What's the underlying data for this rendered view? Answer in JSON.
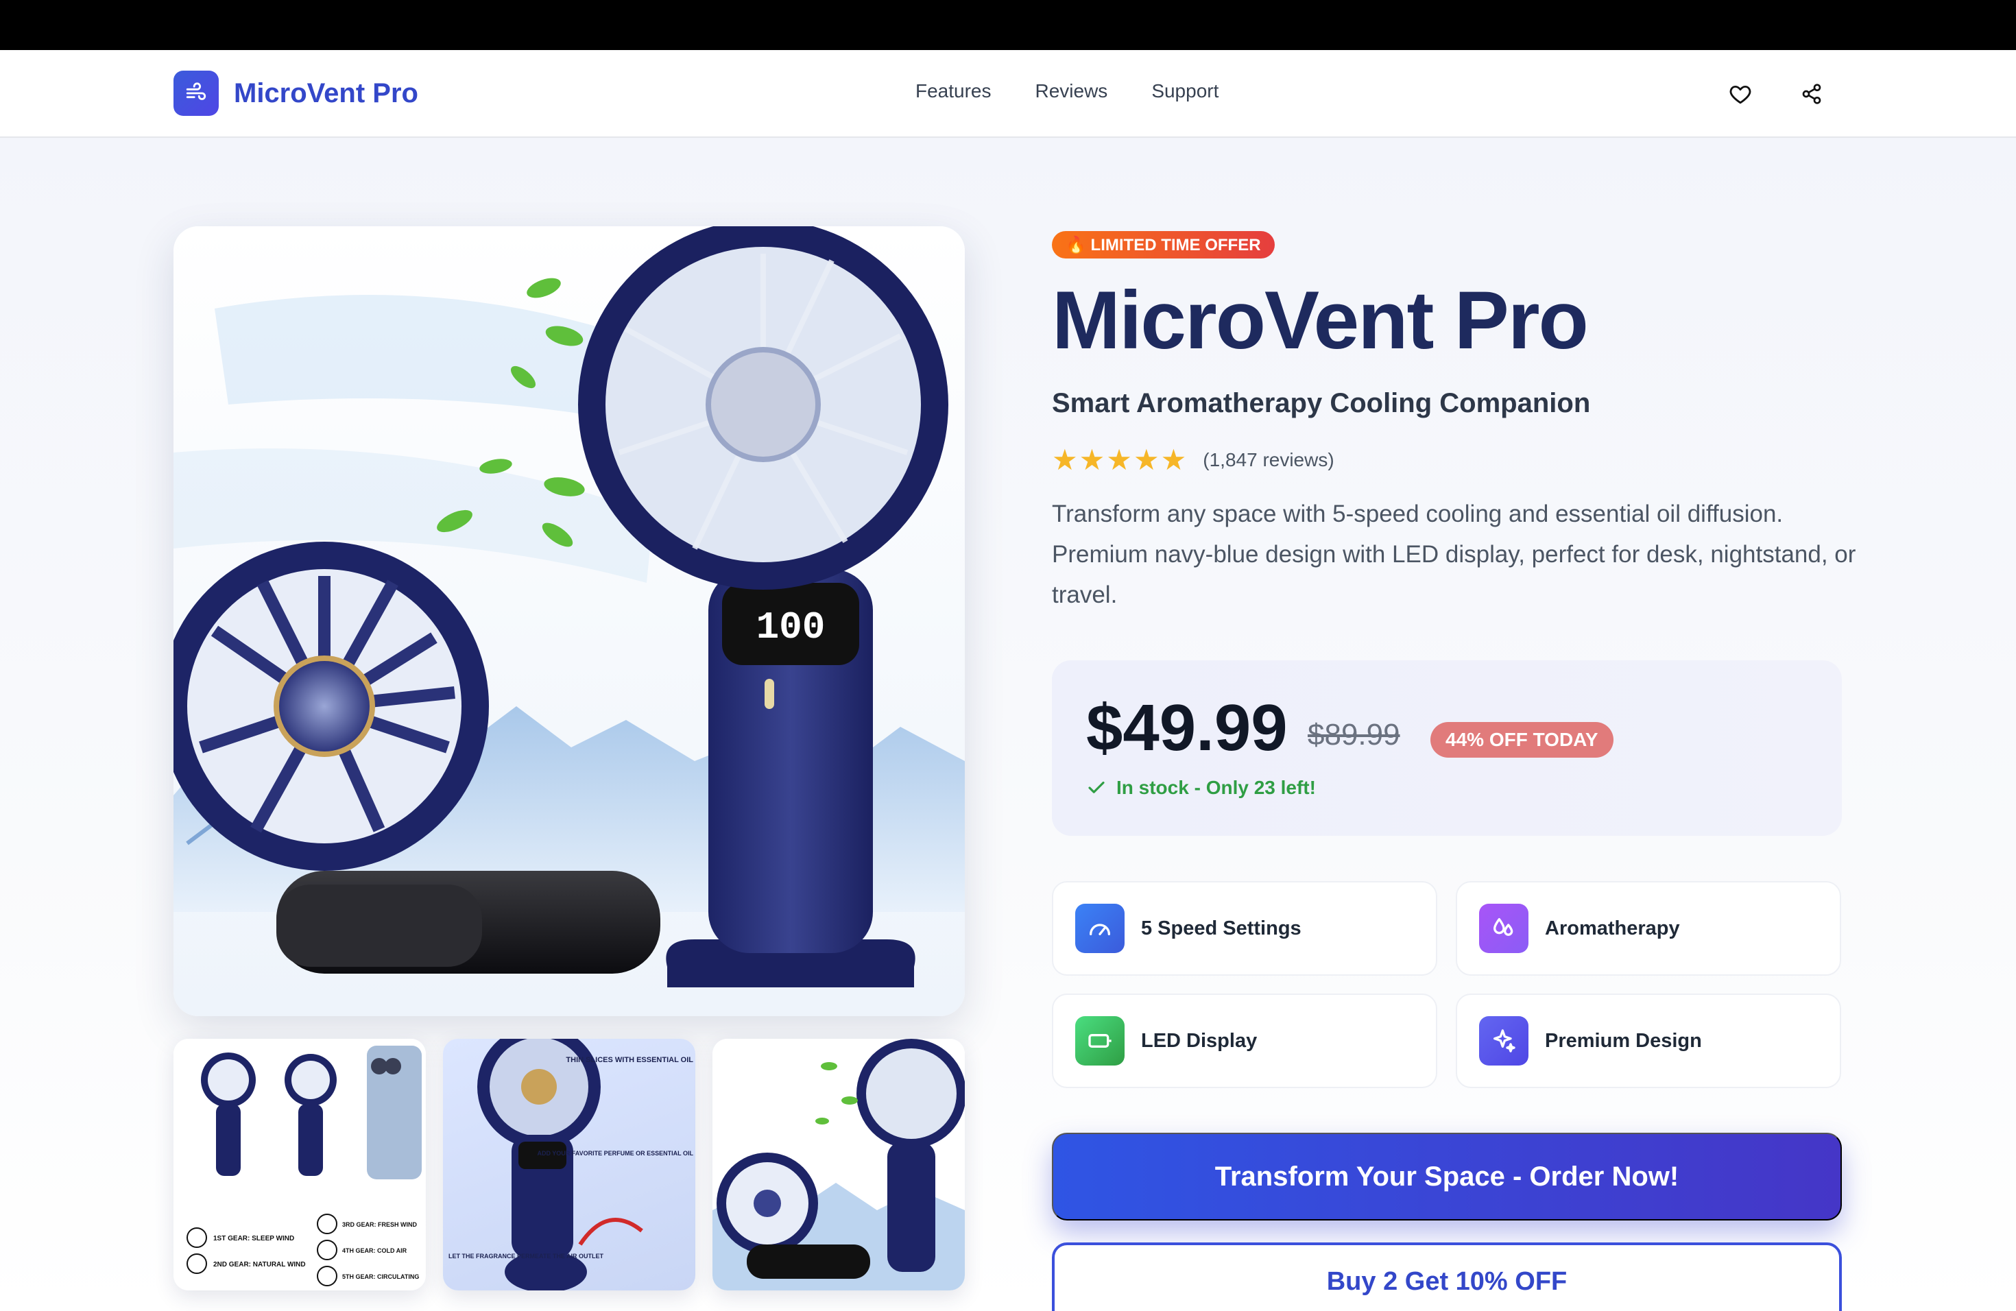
{
  "nav": {
    "brand": "MicroVent Pro",
    "links": [
      "Features",
      "Reviews",
      "Support"
    ],
    "icons": [
      "heart-icon",
      "share-icon"
    ]
  },
  "product": {
    "badge": "🔥 LIMITED TIME OFFER",
    "title": "MicroVent Pro",
    "subtitle": "Smart Aromatherapy Cooling Companion",
    "rating_stars": "★★★★★",
    "rating": 5,
    "review_count": "(1,847 reviews)",
    "description": "Transform any space with 5-speed cooling and essential oil diffusion. Premium navy-blue design with LED display, perfect for desk, nightstand, or travel.",
    "display_readout": "100",
    "price": "$49.99",
    "old_price": "$89.99",
    "discount": "44% OFF TODAY",
    "stock": "In stock - Only 23 left!",
    "features": [
      {
        "label": "5 Speed Settings",
        "icon": "gauge-icon",
        "color": "#3b6fe8"
      },
      {
        "label": "Aromatherapy",
        "icon": "droplets-icon",
        "color": "#a855f7"
      },
      {
        "label": "LED Display",
        "icon": "battery-icon",
        "color": "#3fae5a"
      },
      {
        "label": "Premium Design",
        "icon": "sparkles-icon",
        "color": "#5048e5"
      }
    ],
    "cta_primary": "Transform Your Space - Order Now!",
    "cta_secondary": "Buy 2 Get 10% OFF",
    "thumbnails": [
      {
        "texts": [
          "1ST GEAR: SLEEP WIND",
          "2ND GEAR: NATURAL WIND",
          "3RD GEAR: FRESH WIND",
          "4TH GEAR: COLD AIR",
          "5TH GEAR: CIRCULATING"
        ]
      },
      {
        "texts": [
          "THIN SLICES WITH ESSENTIAL OIL",
          "ADD YOUR FAVORITE PERFUME OR ESSENTIAL OIL",
          "LET THE FRAGRANCE PERMEATE THE AIR OUTLET"
        ]
      },
      {
        "texts": []
      }
    ]
  },
  "colors": {
    "brand": "#3347c9",
    "title": "#1e2a5e",
    "stock": "#2f9e44",
    "discount": "#e17b7b"
  }
}
